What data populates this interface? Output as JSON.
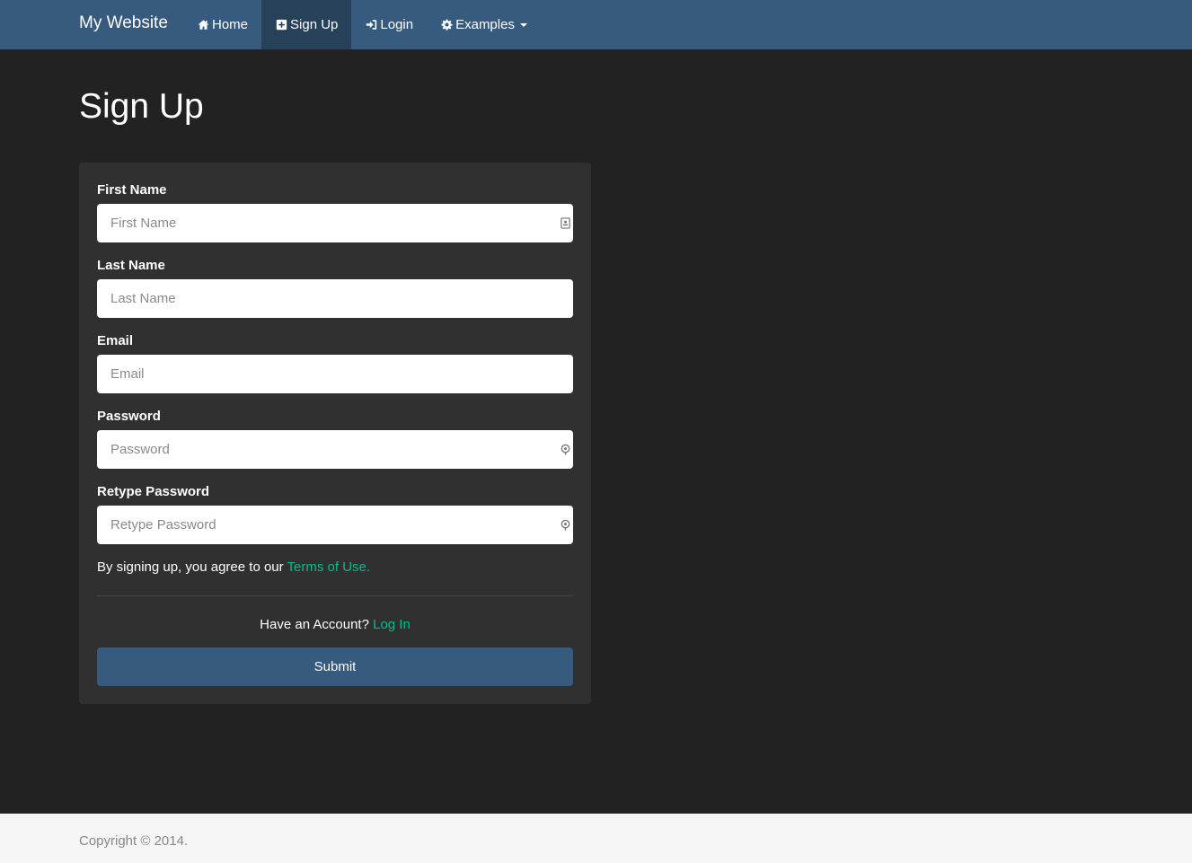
{
  "navbar": {
    "brand": "My Website",
    "items": [
      {
        "label": "Home",
        "icon": "home-icon"
      },
      {
        "label": "Sign Up",
        "icon": "plus-square-icon",
        "active": true
      },
      {
        "label": "Login",
        "icon": "sign-in-icon"
      },
      {
        "label": "Examples",
        "icon": "gear-icon",
        "dropdown": true
      }
    ]
  },
  "page": {
    "title": "Sign Up"
  },
  "form": {
    "first_name": {
      "label": "First Name",
      "placeholder": "First Name",
      "value": "",
      "icon": "contact-card-icon"
    },
    "last_name": {
      "label": "Last Name",
      "placeholder": "Last Name",
      "value": ""
    },
    "email": {
      "label": "Email",
      "placeholder": "Email",
      "value": ""
    },
    "password": {
      "label": "Password",
      "placeholder": "Password",
      "value": "",
      "icon": "password-key-icon"
    },
    "retype_password": {
      "label": "Retype Password",
      "placeholder": "Retype Password",
      "value": "",
      "icon": "password-key-icon"
    },
    "terms_text": "By signing up, you agree to our",
    "terms_link": "Terms of Use.",
    "account_text": "Have an Account?",
    "login_link": "Log In",
    "submit_label": "Submit"
  },
  "footer": {
    "copyright": "Copyright © 2014."
  },
  "colors": {
    "navbar": "#375a7f",
    "navbar_active": "#28415b",
    "background": "#222222",
    "panel": "#303030",
    "link": "#00bc8c",
    "footer": "#f5f5f5"
  }
}
